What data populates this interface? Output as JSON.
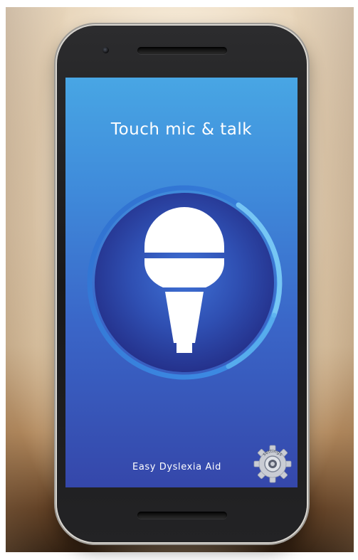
{
  "screen": {
    "title": "Touch mic & talk",
    "app_name": "Easy Dyslexia Aid"
  },
  "mic_button": {
    "icon": "microphone-icon",
    "state": "idle"
  },
  "settings": {
    "icon": "gear-icon",
    "label": "settings"
  },
  "colors": {
    "screen_top": "#48a6e4",
    "screen_bottom": "#3547aa",
    "circle_center": "#3a63c9",
    "circle_edge": "#24308a",
    "ring_accent": "#6fc3f3",
    "icon_white": "#ffffff"
  }
}
